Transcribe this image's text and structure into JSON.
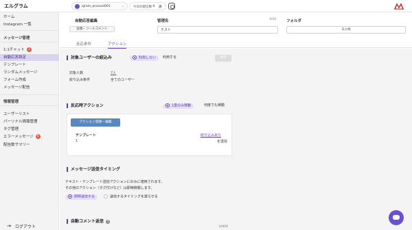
{
  "app": {
    "logo": "エルグラム"
  },
  "header": {
    "account_name": "igram_account001",
    "chevron": "⌄",
    "count_label": "今日の配信数",
    "count_value": "-4",
    "count_unit": "通",
    "instagram_icon": "instagram-icon",
    "brand_icon": "brand-mark-icon",
    "brand_color": "#c0392b"
  },
  "sidebar": {
    "items_top": [
      "ホーム",
      "Instagram 一覧"
    ],
    "section1": "メッセージ管理",
    "section1_items": [
      {
        "label": "1:1チャット",
        "badge": "3"
      },
      {
        "label": "自動応答設定",
        "active": true
      },
      {
        "label": "テンプレート"
      },
      {
        "label": "ランダムメッセージ"
      },
      {
        "label": "フォーム作成"
      },
      {
        "label": "メッセージ配信"
      }
    ],
    "section2": "情報管理",
    "section2_items": [
      {
        "label": "ユーザーリスト"
      },
      {
        "label": "パーソナル情報管理"
      },
      {
        "label": "タグ管理"
      },
      {
        "label": "エラーメッセージ",
        "badge": "6"
      },
      {
        "label": "配信数サマリー"
      }
    ],
    "logout_label": "ログアウト"
  },
  "main": {
    "title": "自動応答編集",
    "type_pill": "投稿・リールコメント",
    "name_label": "管理名",
    "name_value": "テスト",
    "name_count": "3/20",
    "folder_label": "フォルダ",
    "folder_value": "未分類",
    "tabs": [
      "反応条件",
      "アクション"
    ],
    "target_section": {
      "title": "対象ユーザーの絞込み",
      "opt_off": "利用しない",
      "opt_on": "利用する",
      "save": "保存",
      "count_label": "対象人数",
      "count_value": "7人",
      "cond_label": "絞り込み条件",
      "cond_value": "全てのユーザー"
    },
    "action_section": {
      "title": "反応時アクション",
      "opt_once": "1度のみ稼動",
      "opt_every": "何度でも稼動",
      "button": "アクション登録・編集",
      "template_label": "テンプレート",
      "template_num": "1",
      "filter_link": "絞り込みあり",
      "send_label": "を送信"
    },
    "timing_section": {
      "title": "メッセージ送信タイミング",
      "desc1": "テキスト・テンプレート送信アクションにのみに適用されます。",
      "desc2": "その他のアクション（タグ付けなど）は即時稼働します。",
      "opt_now": "即時送信する",
      "opt_set": "送信するタイミングを遅らせる"
    },
    "auto_comment": {
      "title": "自動コメント返信",
      "count": "0/400"
    }
  },
  "chat_fab_icon": "chat-bubble-icon"
}
